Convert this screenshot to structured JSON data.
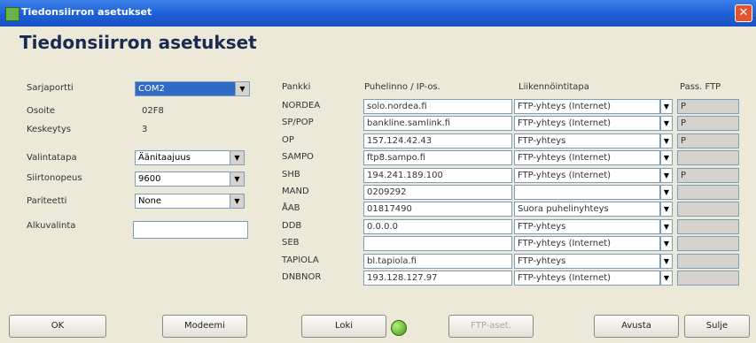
{
  "window": {
    "title": "Tiedonsiirron asetukset",
    "heading": "Tiedonsiirron asetukset"
  },
  "settings": {
    "port_label": "Sarjaportti",
    "port_value": "COM2",
    "address_label": "Osoite",
    "address_value": "02F8",
    "interrupt_label": "Keskeytys",
    "interrupt_value": "3",
    "dial_label": "Valintatapa",
    "dial_value": "Äänitaajuus",
    "speed_label": "Siirtonopeus",
    "speed_value": "9600",
    "parity_label": "Pariteetti",
    "parity_value": "None",
    "init_label": "Alkuvalinta",
    "init_value": ""
  },
  "table": {
    "headers": {
      "bank": "Pankki",
      "phone": "Puhelinno / IP-os.",
      "method": "Liikennöintitapa",
      "pass": "Pass. FTP"
    },
    "rows": [
      {
        "bank": "NORDEA",
        "phone": "solo.nordea.fi",
        "method": "FTP-yhteys (Internet)",
        "pass": "P"
      },
      {
        "bank": "SP/POP",
        "phone": "bankline.samlink.fi",
        "method": "FTP-yhteys (Internet)",
        "pass": "P"
      },
      {
        "bank": "OP",
        "phone": "157.124.42.43",
        "method": "FTP-yhteys",
        "pass": "P"
      },
      {
        "bank": "SAMPO",
        "phone": "ftp8.sampo.fi",
        "method": "FTP-yhteys (Internet)",
        "pass": ""
      },
      {
        "bank": "SHB",
        "phone": "194.241.189.100",
        "method": "FTP-yhteys (Internet)",
        "pass": "P"
      },
      {
        "bank": "MAND",
        "phone": "0209292",
        "method": "",
        "pass": ""
      },
      {
        "bank": "ÅAB",
        "phone": "01817490",
        "method": "Suora puhelinyhteys",
        "pass": ""
      },
      {
        "bank": "DDB",
        "phone": "0.0.0.0",
        "method": "FTP-yhteys",
        "pass": ""
      },
      {
        "bank": "SEB",
        "phone": "",
        "method": "FTP-yhteys (Internet)",
        "pass": ""
      },
      {
        "bank": "TAPIOLA",
        "phone": "bl.tapiola.fi",
        "method": "FTP-yhteys",
        "pass": ""
      },
      {
        "bank": "DNBNOR",
        "phone": "193.128.127.97",
        "method": "FTP-yhteys (Internet)",
        "pass": ""
      }
    ]
  },
  "buttons": {
    "ok": "OK",
    "modem": "Modeemi",
    "log": "Loki",
    "ftp": "FTP-aset.",
    "help": "Avusta",
    "close": "Sulje"
  },
  "icons": {
    "dropdown": "▼",
    "close": "✕"
  }
}
